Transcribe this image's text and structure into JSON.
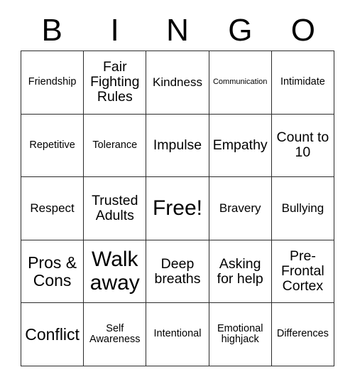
{
  "header": {
    "letters": [
      "B",
      "I",
      "N",
      "G",
      "O"
    ]
  },
  "grid": {
    "rows": [
      [
        {
          "label": "Friendship",
          "size": "sm"
        },
        {
          "label": "Fair Fighting Rules",
          "size": "lg"
        },
        {
          "label": "Kindness",
          "size": "md"
        },
        {
          "label": "Communication",
          "size": "xs"
        },
        {
          "label": "Intimidate",
          "size": "sm"
        }
      ],
      [
        {
          "label": "Repetitive",
          "size": "sm"
        },
        {
          "label": "Tolerance",
          "size": "sm"
        },
        {
          "label": "Impulse",
          "size": "lg"
        },
        {
          "label": "Empathy",
          "size": "lg"
        },
        {
          "label": "Count to 10",
          "size": "lg"
        }
      ],
      [
        {
          "label": "Respect",
          "size": "md"
        },
        {
          "label": "Trusted Adults",
          "size": "lg"
        },
        {
          "label": "Free!",
          "size": "xxl"
        },
        {
          "label": "Bravery",
          "size": "md"
        },
        {
          "label": "Bullying",
          "size": "md"
        }
      ],
      [
        {
          "label": "Pros & Cons",
          "size": "xl"
        },
        {
          "label": "Walk away",
          "size": "xxl"
        },
        {
          "label": "Deep breaths",
          "size": "lg"
        },
        {
          "label": "Asking for help",
          "size": "lg"
        },
        {
          "label": "Pre-Frontal Cortex",
          "size": "lg"
        }
      ],
      [
        {
          "label": "Conflict",
          "size": "xl"
        },
        {
          "label": "Self Awareness",
          "size": "sm"
        },
        {
          "label": "Intentional",
          "size": "sm"
        },
        {
          "label": "Emotional highjack",
          "size": "sm"
        },
        {
          "label": "Differences",
          "size": "sm"
        }
      ]
    ]
  },
  "colors": {
    "background": "#ffffff",
    "text": "#000000",
    "grid_line": "#2b2b2b"
  }
}
